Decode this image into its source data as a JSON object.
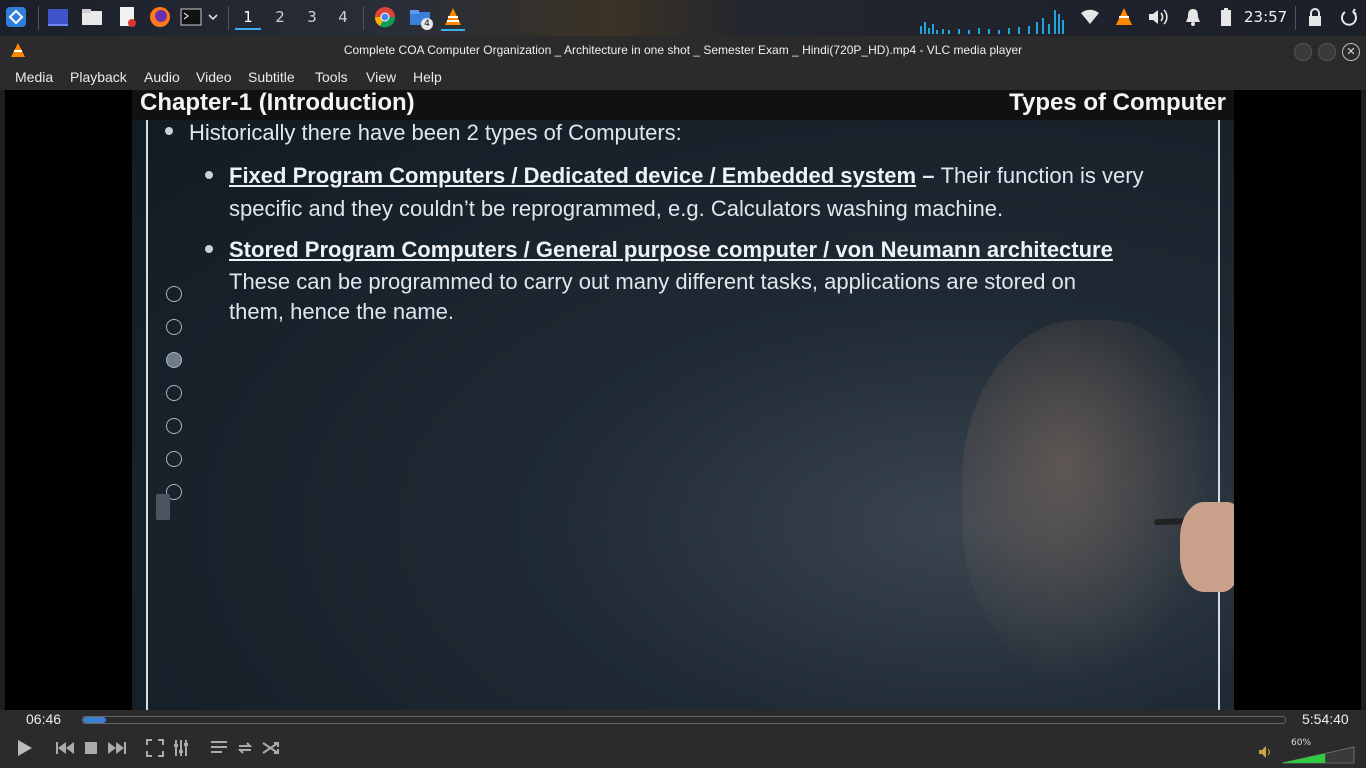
{
  "taskbar": {
    "workspaces": [
      "1",
      "2",
      "3",
      "4"
    ],
    "active_workspace": "1",
    "notification_count": "4",
    "clock": "23:57",
    "icons": [
      "launcher-icon",
      "desktop-icon",
      "file-manager-icon",
      "text-editor-icon",
      "firefox-icon",
      "terminal-icon",
      "chevron-down-icon",
      "chrome-icon",
      "folder-icon",
      "vlc-icon",
      "wifi-icon",
      "vlc-tray-icon",
      "volume-icon",
      "bell-icon",
      "battery-icon",
      "lock-icon",
      "power-icon"
    ]
  },
  "window": {
    "title": "Complete COA Computer Organization _ Architecture in one shot _ Semester Exam _ Hindi(720P_HD).mp4 - VLC media player",
    "close_glyph": "✕"
  },
  "menu": [
    "Media",
    "Playback",
    "Audio",
    "Video",
    "Subtitle",
    "Tools",
    "View",
    "Help"
  ],
  "slide": {
    "chapter": "Chapter-1 (Introduction)",
    "topic": "Types of Computer",
    "intro": "Historically there have been 2 types of Computers:",
    "items": [
      {
        "heading": "Fixed Program Computers / Dedicated device / Embedded system",
        "dash": " – ",
        "text_line1": "Their function is very",
        "text_line2": "specific and they couldn’t be reprogrammed, e.g. Calculators washing machine."
      },
      {
        "heading": "Stored Program Computers / General purpose computer / von Neumann architecture",
        "text_line1": "These can be programmed to carry out many different tasks, applications are stored on",
        "text_line2": "them, hence the name."
      }
    ]
  },
  "player": {
    "current_time": "06:46",
    "total_time": "5:54:40",
    "progress_fraction": 0.019,
    "volume_label": "60%",
    "volume_fraction": 0.6,
    "accent": "#3d7fd0"
  }
}
